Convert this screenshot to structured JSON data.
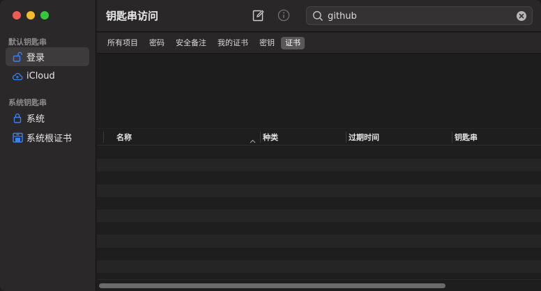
{
  "window": {
    "traffic_lights": {
      "close": "#ee5b54",
      "minimize": "#f1bd2e",
      "zoom": "#39c63f"
    }
  },
  "app": {
    "title": "钥匙串访问"
  },
  "sidebar": {
    "default_section": "默认钥匙串",
    "default_items": [
      {
        "label": "登录",
        "icon": "unlock-icon",
        "selected": true
      },
      {
        "label": "iCloud",
        "icon": "cloud-icon",
        "selected": false
      }
    ],
    "system_section": "系统钥匙串",
    "system_items": [
      {
        "label": "系统",
        "icon": "lock-icon",
        "selected": false
      },
      {
        "label": "系统根证书",
        "icon": "cabinet-icon",
        "selected": false
      }
    ]
  },
  "toolbar": {
    "compose_icon": "compose-icon",
    "info_icon": "info-icon"
  },
  "search": {
    "value": "github",
    "icon": "search-icon",
    "clear_icon": "clear-icon"
  },
  "tabs": [
    {
      "label": "所有项目",
      "active": false
    },
    {
      "label": "密码",
      "active": false
    },
    {
      "label": "安全备注",
      "active": false
    },
    {
      "label": "我的证书",
      "active": false
    },
    {
      "label": "密钥",
      "active": false
    },
    {
      "label": "证书",
      "active": true
    }
  ],
  "table": {
    "columns": [
      {
        "label": "名称",
        "sorted": "ascending"
      },
      {
        "label": "种类"
      },
      {
        "label": "过期时间"
      },
      {
        "label": "钥匙串"
      }
    ],
    "rows": []
  },
  "colors": {
    "sidebar_bg": "#2b2829",
    "selected_bg": "#3e3b3c",
    "accent_icon": "#3b82f6",
    "active_tab_bg": "#5b5859"
  }
}
